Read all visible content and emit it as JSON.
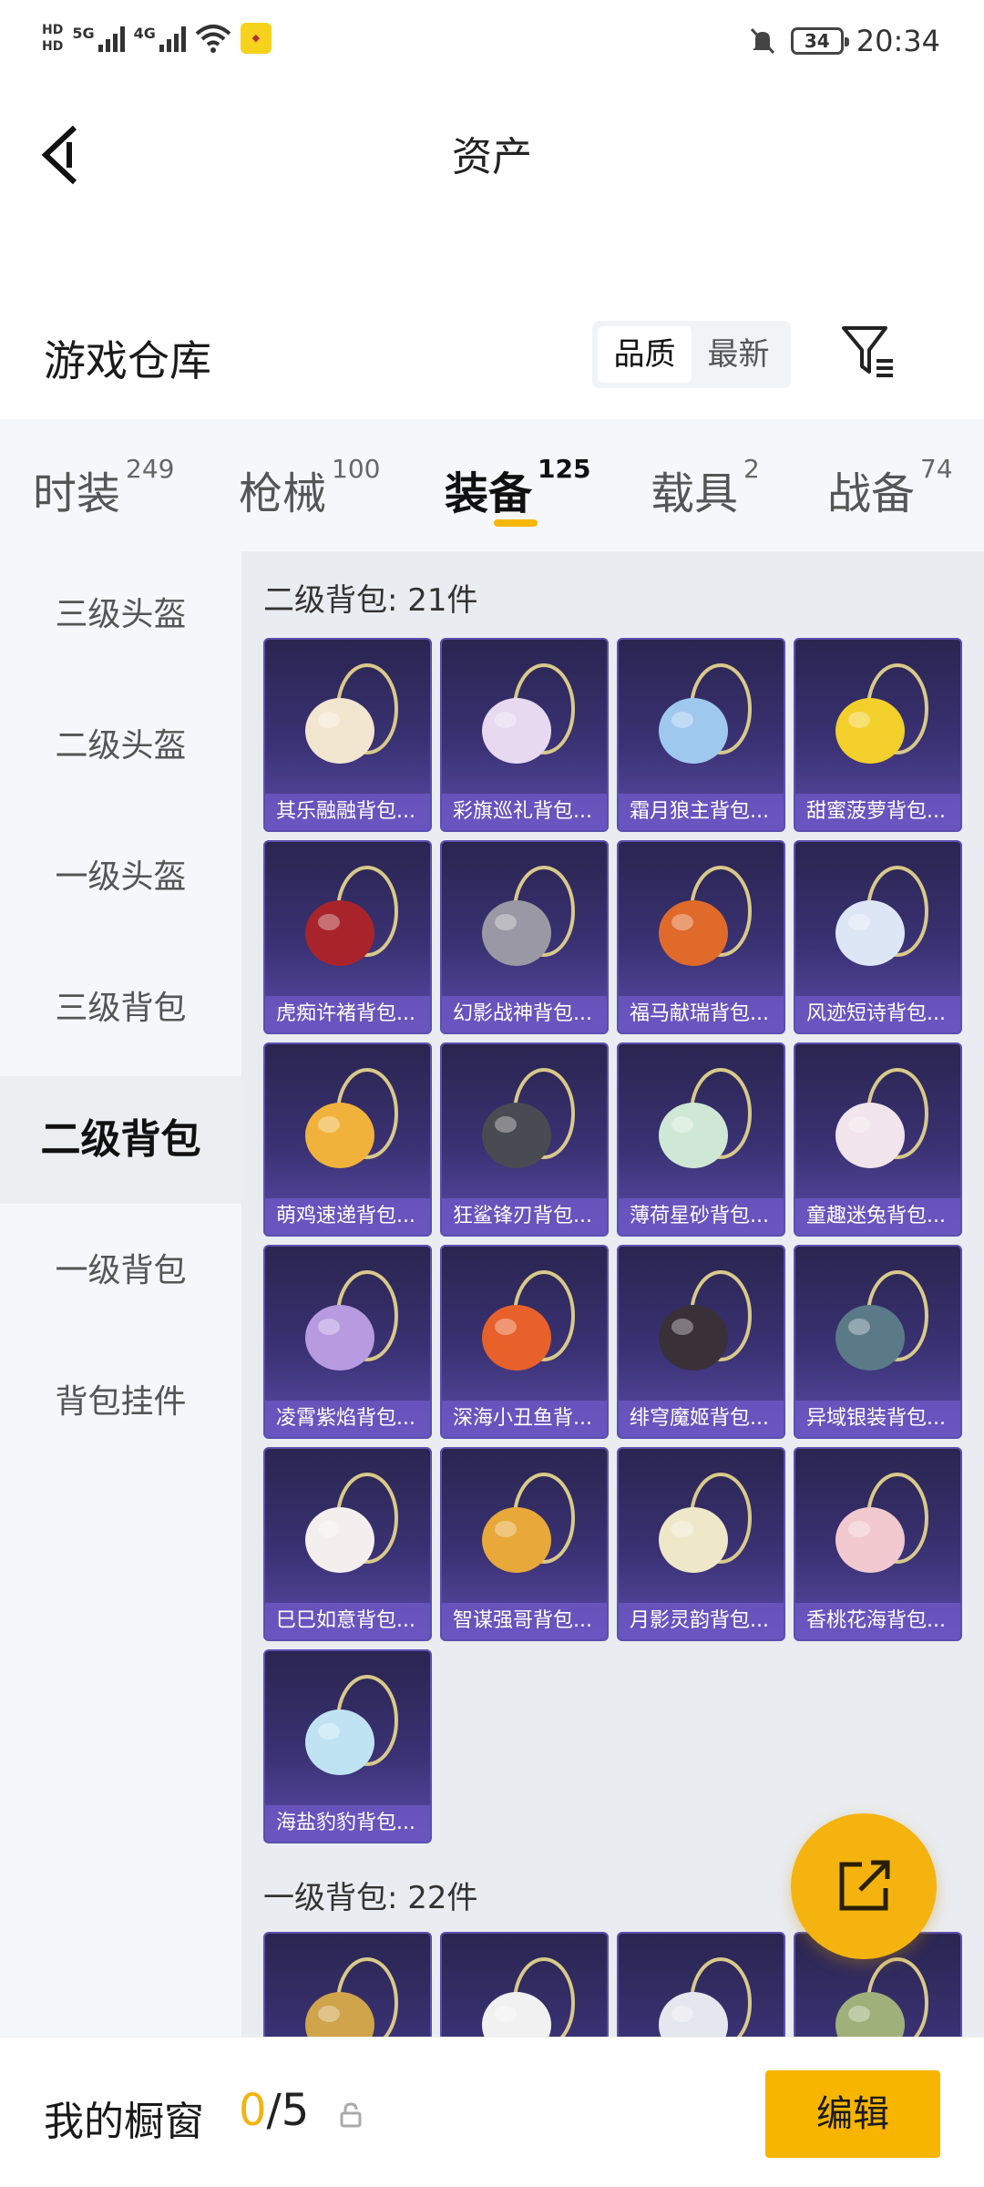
{
  "status_bar": {
    "hd_top": "HD",
    "hd_bottom": "HD",
    "net_label": "5G",
    "net_label2": "4G",
    "battery": "34",
    "time": "20:34"
  },
  "header": {
    "title": "资产"
  },
  "warehouse": {
    "title": "游戏仓库",
    "sort_options": [
      "品质",
      "最新"
    ],
    "active_sort": "品质"
  },
  "tabs": [
    {
      "label": "时装",
      "count": "249"
    },
    {
      "label": "枪械",
      "count": "100"
    },
    {
      "label": "装备",
      "count": "125",
      "active": true
    },
    {
      "label": "载具",
      "count": "2"
    },
    {
      "label": "战备",
      "count": "74"
    }
  ],
  "sidebar": {
    "items": [
      "三级头盔",
      "二级头盔",
      "一级头盔",
      "三级背包",
      "二级背包",
      "一级背包",
      "背包挂件"
    ],
    "active": "二级背包"
  },
  "sections": [
    {
      "title": "二级背包: 21件",
      "items": [
        {
          "label": "其乐融融背包...",
          "icon": "cupcake-backpack-icon",
          "color": "#f3e6d0"
        },
        {
          "label": "彩旗巡礼背包...",
          "icon": "bow-backpack-icon",
          "color": "#e6d9f0"
        },
        {
          "label": "霜月狼主背包...",
          "icon": "crystal-backpack-icon",
          "color": "#9fc8ef"
        },
        {
          "label": "甜蜜菠萝背包...",
          "icon": "pineapple-backpack-icon",
          "color": "#f2cf2a"
        },
        {
          "label": "虎痴许褚背包...",
          "icon": "beast-mask-backpack-icon",
          "color": "#a8242a"
        },
        {
          "label": "幻影战神背包...",
          "icon": "armored-backpack-icon",
          "color": "#9a98a4"
        },
        {
          "label": "福马献瑞背包...",
          "icon": "horse-backpack-icon",
          "color": "#e06a2a"
        },
        {
          "label": "风迹短诗背包...",
          "icon": "pastel-box-backpack-icon",
          "color": "#dde6f5"
        },
        {
          "label": "萌鸡速递背包...",
          "icon": "chick-backpack-icon",
          "color": "#f0b23a"
        },
        {
          "label": "狂鲨锋刃背包...",
          "icon": "shark-backpack-icon",
          "color": "#4a4a52"
        },
        {
          "label": "薄荷星砂背包...",
          "icon": "mint-bag-backpack-icon",
          "color": "#cfe8d5"
        },
        {
          "label": "童趣迷兔背包...",
          "icon": "bunny-backpack-icon",
          "color": "#f1e4ea"
        },
        {
          "label": "凌霄紫焰背包...",
          "icon": "violet-amulet-backpack-icon",
          "color": "#b79ae0"
        },
        {
          "label": "深海小丑鱼背...",
          "icon": "clownfish-backpack-icon",
          "color": "#e8602a"
        },
        {
          "label": "绯穹魔姬背包...",
          "icon": "bat-backpack-icon",
          "color": "#3a3038"
        },
        {
          "label": "异域银装背包...",
          "icon": "tech-backpack-icon",
          "color": "#5a7a88"
        },
        {
          "label": "巳巳如意背包...",
          "icon": "snake-backpack-icon",
          "color": "#f4eeee"
        },
        {
          "label": "智谋强哥背包...",
          "icon": "headphone-backpack-icon",
          "color": "#e8a83a"
        },
        {
          "label": "月影灵韵背包...",
          "icon": "moon-backpack-icon",
          "color": "#efe8c8"
        },
        {
          "label": "香桃花海背包...",
          "icon": "peach-backpack-icon",
          "color": "#f1c9cf"
        },
        {
          "label": "海盐豹豹背包...",
          "icon": "seal-backpack-icon",
          "color": "#bfe3f2"
        }
      ]
    },
    {
      "title": "一级背包: 22件",
      "items": [
        {
          "label": "",
          "icon": "gold-backpack-icon",
          "color": "#d0a44a"
        },
        {
          "label": "",
          "icon": "white-rabbit-backpack-icon",
          "color": "#f1f1f1"
        },
        {
          "label": "",
          "icon": "white-bag-backpack-icon",
          "color": "#e6e6ee"
        },
        {
          "label": "",
          "icon": "sprout-backpack-icon",
          "color": "#9fb07a"
        }
      ]
    }
  ],
  "bottom_bar": {
    "showcase_label": "我的橱窗",
    "showcase_current": "0",
    "showcase_total": "/5",
    "edit_label": "编辑"
  }
}
